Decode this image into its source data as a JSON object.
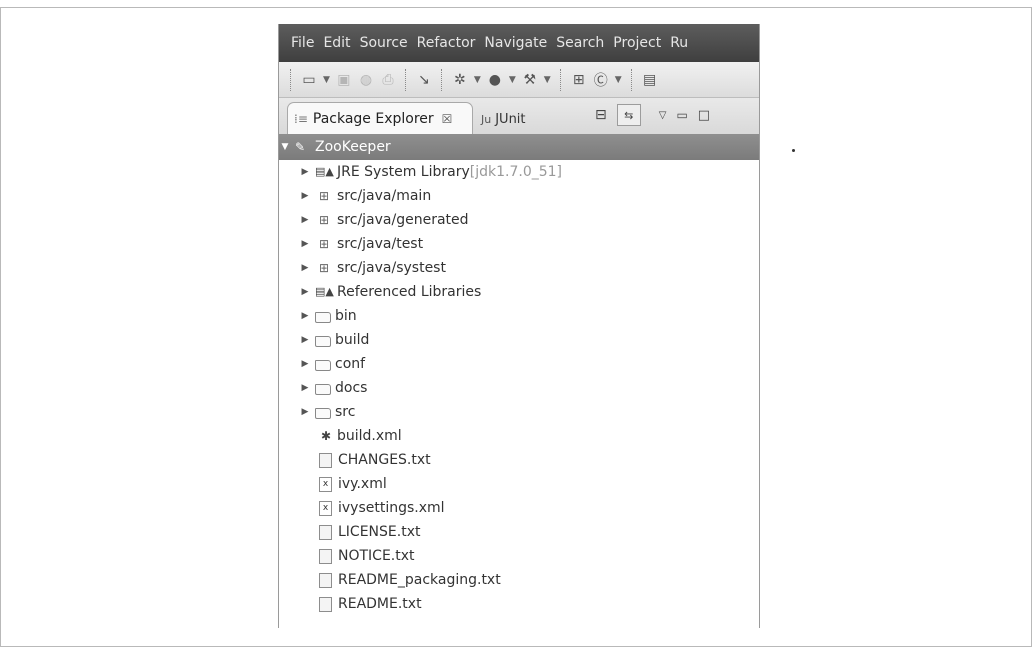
{
  "menubar": {
    "items": [
      "File",
      "Edit",
      "Source",
      "Refactor",
      "Navigate",
      "Search",
      "Project",
      "Ru"
    ]
  },
  "tabs": {
    "package_explorer": {
      "label": "Package Explorer",
      "close": "☒"
    },
    "junit": {
      "label": "JUnit",
      "prefix": "Ju"
    }
  },
  "tree": {
    "project": {
      "label": "ZooKeeper",
      "expanded": true
    },
    "items": [
      {
        "label": "JRE System Library",
        "suffix": " [jdk1.7.0_51]",
        "icon": "library-icon"
      },
      {
        "label": "src/java/main",
        "icon": "source-folder-icon"
      },
      {
        "label": "src/java/generated",
        "icon": "source-folder-icon"
      },
      {
        "label": "src/java/test",
        "icon": "source-folder-icon"
      },
      {
        "label": "src/java/systest",
        "icon": "source-folder-icon"
      },
      {
        "label": "Referenced Libraries",
        "icon": "library-icon"
      },
      {
        "label": "bin",
        "icon": "folder-icon"
      },
      {
        "label": "build",
        "icon": "folder-icon"
      },
      {
        "label": "conf",
        "icon": "folder-icon"
      },
      {
        "label": "docs",
        "icon": "folder-icon"
      },
      {
        "label": "src",
        "icon": "folder-icon"
      },
      {
        "label": "build.xml",
        "icon": "ant-file-icon"
      },
      {
        "label": "CHANGES.txt",
        "icon": "text-file-icon"
      },
      {
        "label": "ivy.xml",
        "icon": "xml-file-icon"
      },
      {
        "label": "ivysettings.xml",
        "icon": "xml-file-icon"
      },
      {
        "label": "LICENSE.txt",
        "icon": "text-file-icon"
      },
      {
        "label": "NOTICE.txt",
        "icon": "text-file-icon"
      },
      {
        "label": "README_packaging.txt",
        "icon": "text-file-icon"
      },
      {
        "label": "README.txt",
        "icon": "text-file-icon"
      }
    ]
  }
}
